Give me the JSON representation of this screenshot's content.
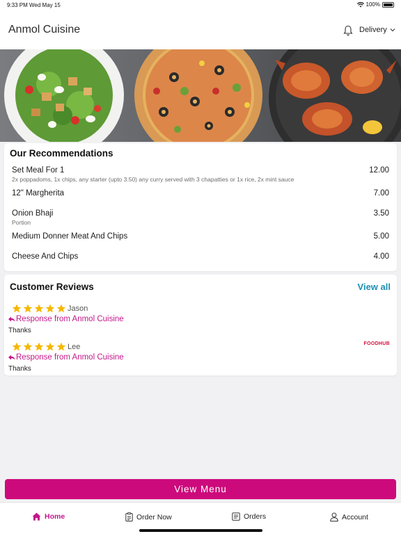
{
  "status_bar": {
    "time": "9:33 PM",
    "date": "Wed May 15",
    "battery": "100%"
  },
  "header": {
    "title": "Anmol Cuisine",
    "mode": "Delivery",
    "icons": [
      "bell-icon",
      "chevron-down-icon"
    ]
  },
  "recommendations": {
    "title": "Our Recommendations",
    "items": [
      {
        "name": "Set Meal For 1",
        "price": "12.00",
        "desc": "2x poppadoms, 1x chips, any starter (upto 3.50) any curry served with 3 chapatties or 1x rice, 2x mint sauce"
      },
      {
        "name": "12\" Margherita",
        "price": "7.00",
        "desc": ""
      },
      {
        "name": "Onion Bhaji",
        "price": "3.50",
        "desc": "Portion"
      },
      {
        "name": "Medium Donner Meat And Chips",
        "price": "5.00",
        "desc": ""
      },
      {
        "name": "Cheese And Chips",
        "price": "4.00",
        "desc": ""
      }
    ]
  },
  "reviews": {
    "title": "Customer Reviews",
    "view_all": "View all",
    "items": [
      {
        "name": "Jason",
        "rating": 5,
        "response_label": "Response from Anmol Cuisine",
        "response": "Thanks"
      },
      {
        "name": "Lee",
        "rating": 5,
        "response_label": "Response from Anmol Cuisine",
        "response": "Thanks"
      }
    ],
    "brand": "FOODHUB"
  },
  "cta": {
    "label": "View Menu"
  },
  "tabs": [
    {
      "label": "Home",
      "icon": "home-icon",
      "active": true
    },
    {
      "label": "Order Now",
      "icon": "clipboard-icon",
      "active": false
    },
    {
      "label": "Orders",
      "icon": "receipt-icon",
      "active": false
    },
    {
      "label": "Account",
      "icon": "person-icon",
      "active": false
    }
  ],
  "colors": {
    "accent": "#cc0a7c",
    "link": "#1c8fb3",
    "star": "#f5b800",
    "background": "#f1f1f3"
  }
}
